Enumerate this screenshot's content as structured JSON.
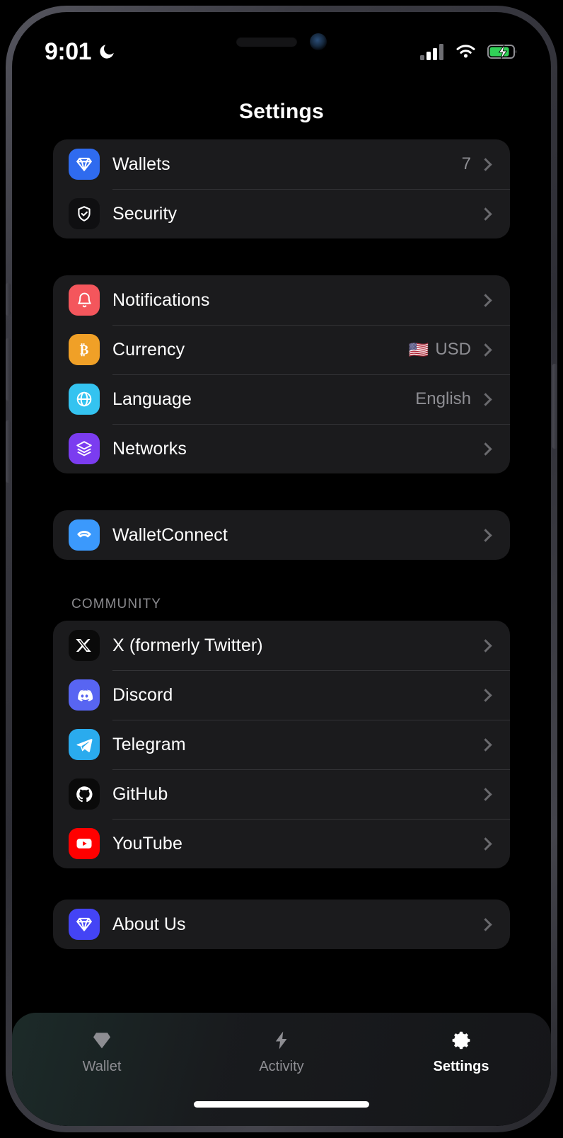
{
  "status_bar": {
    "time": "9:01",
    "dnd_icon": "crescent-moon-icon",
    "cellular_icon": "cellular-signal-icon",
    "wifi_icon": "wifi-icon",
    "battery_icon": "battery-charging-icon"
  },
  "nav": {
    "title": "Settings"
  },
  "groups": [
    {
      "rows": [
        {
          "label": "Wallets",
          "value": "7",
          "icon": "gem-icon",
          "icon_bg": "#2f6bef"
        },
        {
          "label": "Security",
          "value": "",
          "icon": "shield-check-icon",
          "icon_bg": "#0f0f11"
        }
      ]
    },
    {
      "rows": [
        {
          "label": "Notifications",
          "value": "",
          "icon": "bell-icon",
          "icon_bg": "#f4565c"
        },
        {
          "label": "Currency",
          "value": "USD",
          "flag": "🇺🇸",
          "icon": "bitcoin-icon",
          "icon_bg": "#f0a027"
        },
        {
          "label": "Language",
          "value": "English",
          "icon": "globe-icon",
          "icon_bg": "#34c3f0"
        },
        {
          "label": "Networks",
          "value": "",
          "icon": "layers-icon",
          "icon_bg": "#7b3cf0"
        }
      ]
    },
    {
      "rows": [
        {
          "label": "WalletConnect",
          "value": "",
          "icon": "walletconnect-icon",
          "icon_bg": "#3b99fc"
        }
      ]
    }
  ],
  "community": {
    "label": "COMMUNITY",
    "rows": [
      {
        "label": "X (formerly Twitter)",
        "icon": "x-twitter-icon",
        "icon_bg": "#0a0a0a"
      },
      {
        "label": "Discord",
        "icon": "discord-icon",
        "icon_bg": "#5865f2"
      },
      {
        "label": "Telegram",
        "icon": "telegram-icon",
        "icon_bg": "#2aabee"
      },
      {
        "label": "GitHub",
        "icon": "github-icon",
        "icon_bg": "#0a0a0a"
      },
      {
        "label": "YouTube",
        "icon": "youtube-icon",
        "icon_bg": "#ff0000"
      }
    ]
  },
  "about": {
    "rows": [
      {
        "label": "About Us",
        "icon": "gem-icon",
        "icon_bg": "#4444f5"
      }
    ]
  },
  "tab_bar": {
    "tabs": [
      {
        "label": "Wallet",
        "icon": "gem-icon",
        "active": false
      },
      {
        "label": "Activity",
        "icon": "lightning-icon",
        "active": false
      },
      {
        "label": "Settings",
        "icon": "gear-icon",
        "active": true
      }
    ]
  },
  "colors": {
    "page_bg": "#000000",
    "card_bg": "#1b1b1d",
    "divider": "#333336",
    "text_primary": "#ffffff",
    "text_secondary": "#8e8e93",
    "chevron": "#6a6a6e"
  }
}
